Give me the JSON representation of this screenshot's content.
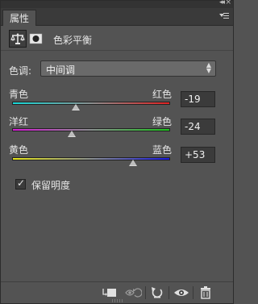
{
  "window": {
    "collapse_glyph": "◂◂",
    "close_glyph": "×"
  },
  "tabs": [
    {
      "label": "属性"
    }
  ],
  "adjustment": {
    "title": "色彩平衡",
    "icons": [
      "balance-scale-icon",
      "layer-mask-icon"
    ]
  },
  "tone": {
    "label": "色调:",
    "selected": "中间调"
  },
  "sliders": [
    {
      "left_label": "青色",
      "right_label": "红色",
      "value": "-19",
      "level": -19
    },
    {
      "left_label": "洋红",
      "right_label": "绿色",
      "value": "-24",
      "level": -24
    },
    {
      "left_label": "黄色",
      "right_label": "蓝色",
      "value": "+53",
      "level": 53
    }
  ],
  "preserve_luminosity": {
    "label": "保留明度",
    "checked": true,
    "check_glyph": "✓"
  },
  "toolbar": {
    "icons": [
      "clip-to-layer-icon",
      "view-previous-icon",
      "reset-icon",
      "visibility-eye-icon",
      "trash-icon"
    ]
  },
  "colors": {
    "panel_bg": "#535353",
    "tab_bg": "#3a3a3a",
    "field_bg": "#3b3b3b"
  }
}
